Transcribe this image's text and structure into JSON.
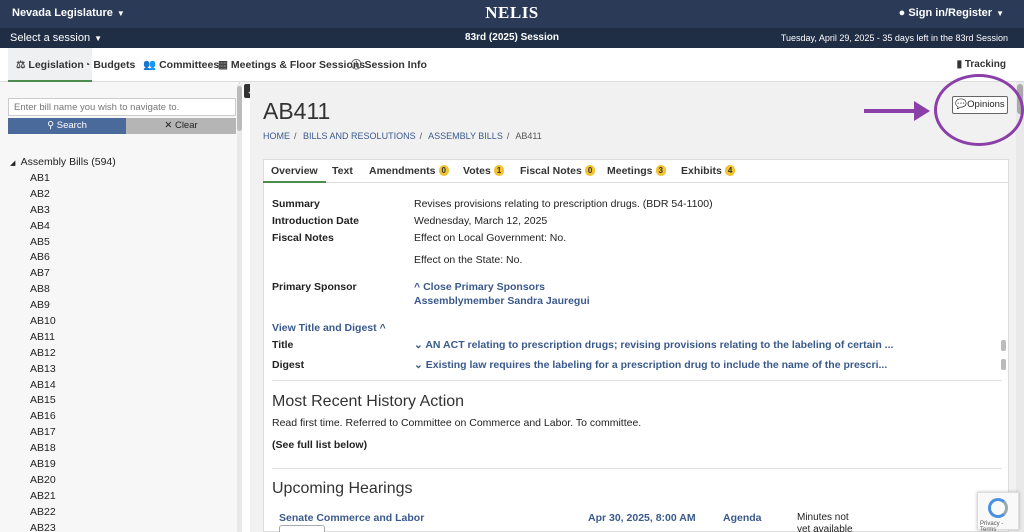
{
  "header": {
    "brand": "Nevada Legislature",
    "logo": "NELIS",
    "signin": "Sign in/Register"
  },
  "session_bar": {
    "select": "Select a session",
    "session": "83rd (2025) Session",
    "date": "Tuesday, April 29, 2025 - 35 days left in the 83rd Session"
  },
  "nav": {
    "items": [
      "Legislation",
      "Budgets",
      "Committees",
      "Meetings & Floor Sessions",
      "Session Info"
    ],
    "tracking": "Tracking"
  },
  "sidebar": {
    "search_placeholder": "Enter bill name you wish to navigate to.",
    "search_label": "Search",
    "clear_label": "Clear",
    "tree_head": "Assembly Bills (594)",
    "bills": [
      "AB1",
      "AB2",
      "AB3",
      "AB4",
      "AB5",
      "AB6",
      "AB7",
      "AB8",
      "AB9",
      "AB10",
      "AB11",
      "AB12",
      "AB13",
      "AB14",
      "AB15",
      "AB16",
      "AB17",
      "AB18",
      "AB19",
      "AB20",
      "AB21",
      "AB22",
      "AB23"
    ]
  },
  "page": {
    "title": "AB411",
    "crumbs": [
      "HOME",
      "BILLS AND RESOLUTIONS",
      "ASSEMBLY BILLS",
      "AB411"
    ],
    "opinions": "Opinions"
  },
  "tabs": [
    {
      "label": "Overview",
      "badge": ""
    },
    {
      "label": "Text",
      "badge": ""
    },
    {
      "label": "Amendments",
      "badge": "0"
    },
    {
      "label": "Votes",
      "badge": "1"
    },
    {
      "label": "Fiscal Notes",
      "badge": "0"
    },
    {
      "label": "Meetings",
      "badge": "3"
    },
    {
      "label": "Exhibits",
      "badge": "4"
    }
  ],
  "overview": {
    "summary_label": "Summary",
    "summary": "Revises provisions relating to prescription drugs. (BDR 54-1100)",
    "intro_label": "Introduction Date",
    "intro": "Wednesday, March 12, 2025",
    "fiscal_label": "Fiscal Notes",
    "fiscal_local": "Effect on Local Government: No.",
    "fiscal_state": "Effect on the State: No.",
    "sponsor_label": "Primary Sponsor",
    "close_sponsors": "Close Primary Sponsors",
    "sponsor": "Assemblymember Sandra Jauregui",
    "view_title_digest": "View Title and Digest",
    "title_label": "Title",
    "title_text": "AN ACT relating to prescription drugs; revising provisions relating to the labeling of certain ...",
    "digest_label": "Digest",
    "digest_text": "Existing law requires the labeling for a prescription drug to include the name of the prescri..."
  },
  "history": {
    "heading": "Most Recent History Action",
    "text": "Read first time. Referred to Committee on Commerce and Labor. To committee.",
    "full_list": "(See full list below)"
  },
  "hearings": {
    "heading": "Upcoming Hearings",
    "committee": "Senate Commerce and Labor",
    "datetime": "Apr 30, 2025, 8:00 AM",
    "agenda": "Agenda",
    "minutes": "Minutes not yet available"
  },
  "recaptcha": {
    "text": "Privacy - Terms"
  }
}
